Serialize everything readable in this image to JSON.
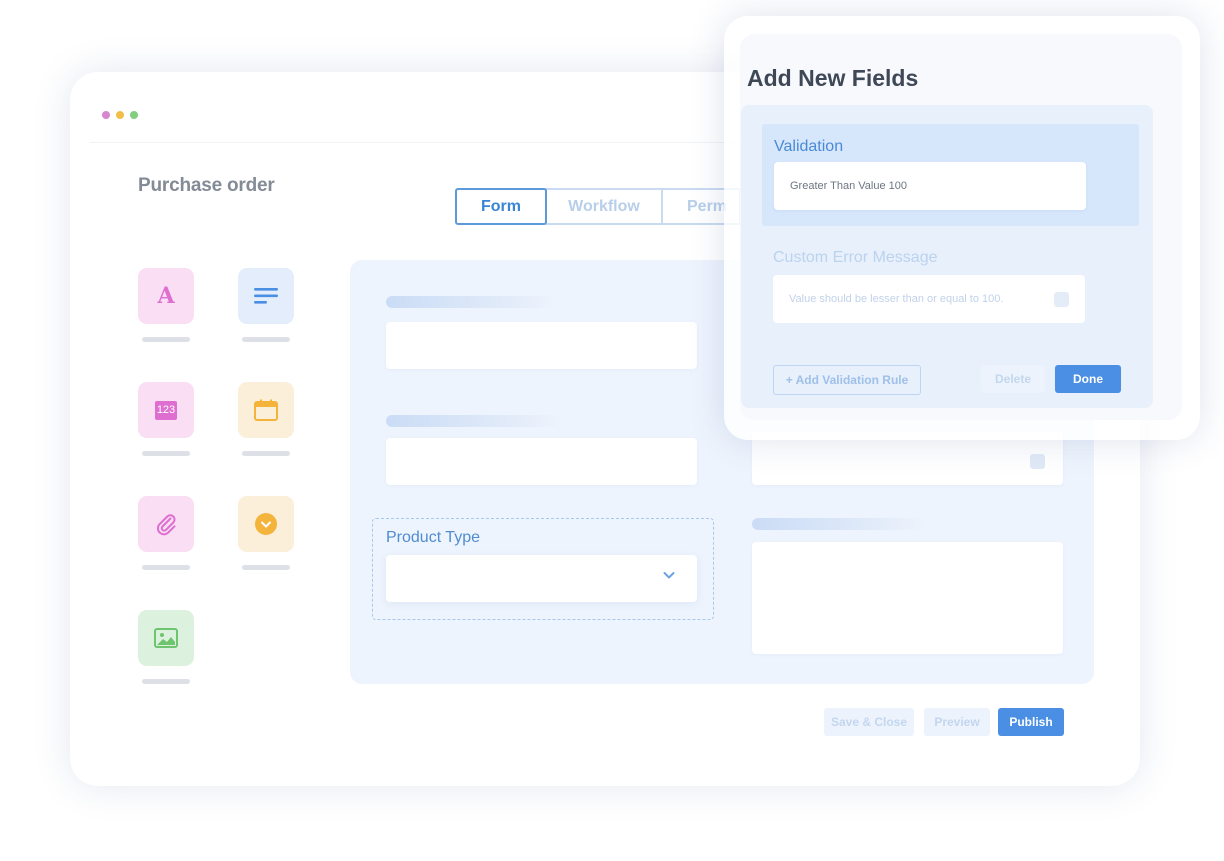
{
  "window": {
    "title": "Purchase order",
    "dot_colors": [
      "#d886d0",
      "#f1bf48",
      "#7fcf7f"
    ]
  },
  "tabs": [
    {
      "label": "Form",
      "active": true
    },
    {
      "label": "Workflow",
      "active": false
    },
    {
      "label": "Perm",
      "active": false
    }
  ],
  "palette": [
    {
      "icon": "text-field-icon",
      "glyph": "A",
      "bg": "#f9def4",
      "color": "#de6fd0"
    },
    {
      "icon": "paragraph-icon",
      "glyph": "",
      "bg": "#e3edfc",
      "color": "#4a8fe3"
    },
    {
      "icon": "number-field-icon",
      "glyph": "123",
      "bg": "#f9def4",
      "color": "#de6fd0"
    },
    {
      "icon": "calendar-icon",
      "glyph": "",
      "bg": "#fbefd9",
      "color": "#f4b43c"
    },
    {
      "icon": "attachment-icon",
      "glyph": "",
      "bg": "#f9def4",
      "color": "#de6fd0"
    },
    {
      "icon": "dropdown-icon",
      "glyph": "",
      "bg": "#fbefd9",
      "color": "#f4b43c"
    },
    {
      "icon": "image-icon",
      "glyph": "",
      "bg": "#dcf2de",
      "color": "#6fc46f"
    }
  ],
  "form": {
    "product_type_label": "Product Type"
  },
  "footer_buttons": {
    "save_close": "Save & Close",
    "preview": "Preview",
    "publish": "Publish"
  },
  "panel": {
    "title": "Add New Fields",
    "validation_label": "Validation",
    "validation_value": "Greater Than Value 100",
    "error_label": "Custom Error Message",
    "error_value": "Value should be lesser than or equal to 100.",
    "add_rule": "+ Add Validation Rule",
    "delete": "Delete",
    "done": "Done"
  },
  "colors": {
    "accent": "#4a8fe3",
    "tab_active": "#3b86d4"
  }
}
